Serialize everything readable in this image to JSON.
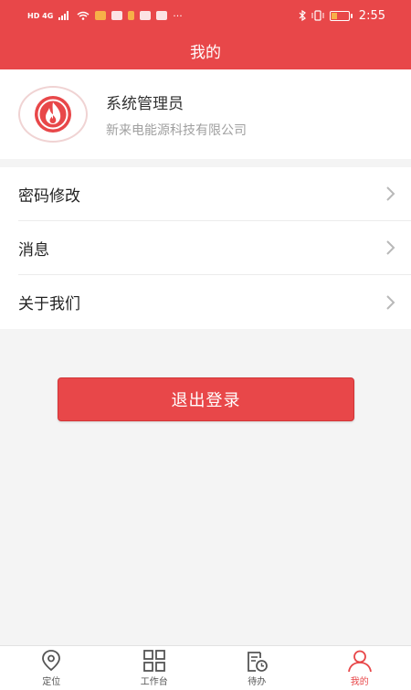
{
  "status_bar": {
    "left_text": "HD 4G",
    "time": "2:55",
    "battery_level": 0.35
  },
  "header": {
    "title": "我的"
  },
  "profile": {
    "name": "系统管理员",
    "company": "新来电能源科技有限公司",
    "avatar_icon": "flame-icon"
  },
  "menu": {
    "items": [
      {
        "label": "密码修改",
        "icon": "chevron-right-icon"
      },
      {
        "label": "消息",
        "icon": "chevron-right-icon"
      },
      {
        "label": "关于我们",
        "icon": "chevron-right-icon"
      }
    ]
  },
  "logout": {
    "label": "退出登录"
  },
  "tabs": [
    {
      "label": "定位",
      "icon": "location-pin-icon",
      "active": false
    },
    {
      "label": "工作台",
      "icon": "grid-icon",
      "active": false
    },
    {
      "label": "待办",
      "icon": "todo-clock-icon",
      "active": false
    },
    {
      "label": "我的",
      "icon": "user-icon",
      "active": true
    }
  ],
  "colors": {
    "primary": "#e84749",
    "background": "#f4f4f4",
    "secondary_text": "#a0a0a0"
  }
}
